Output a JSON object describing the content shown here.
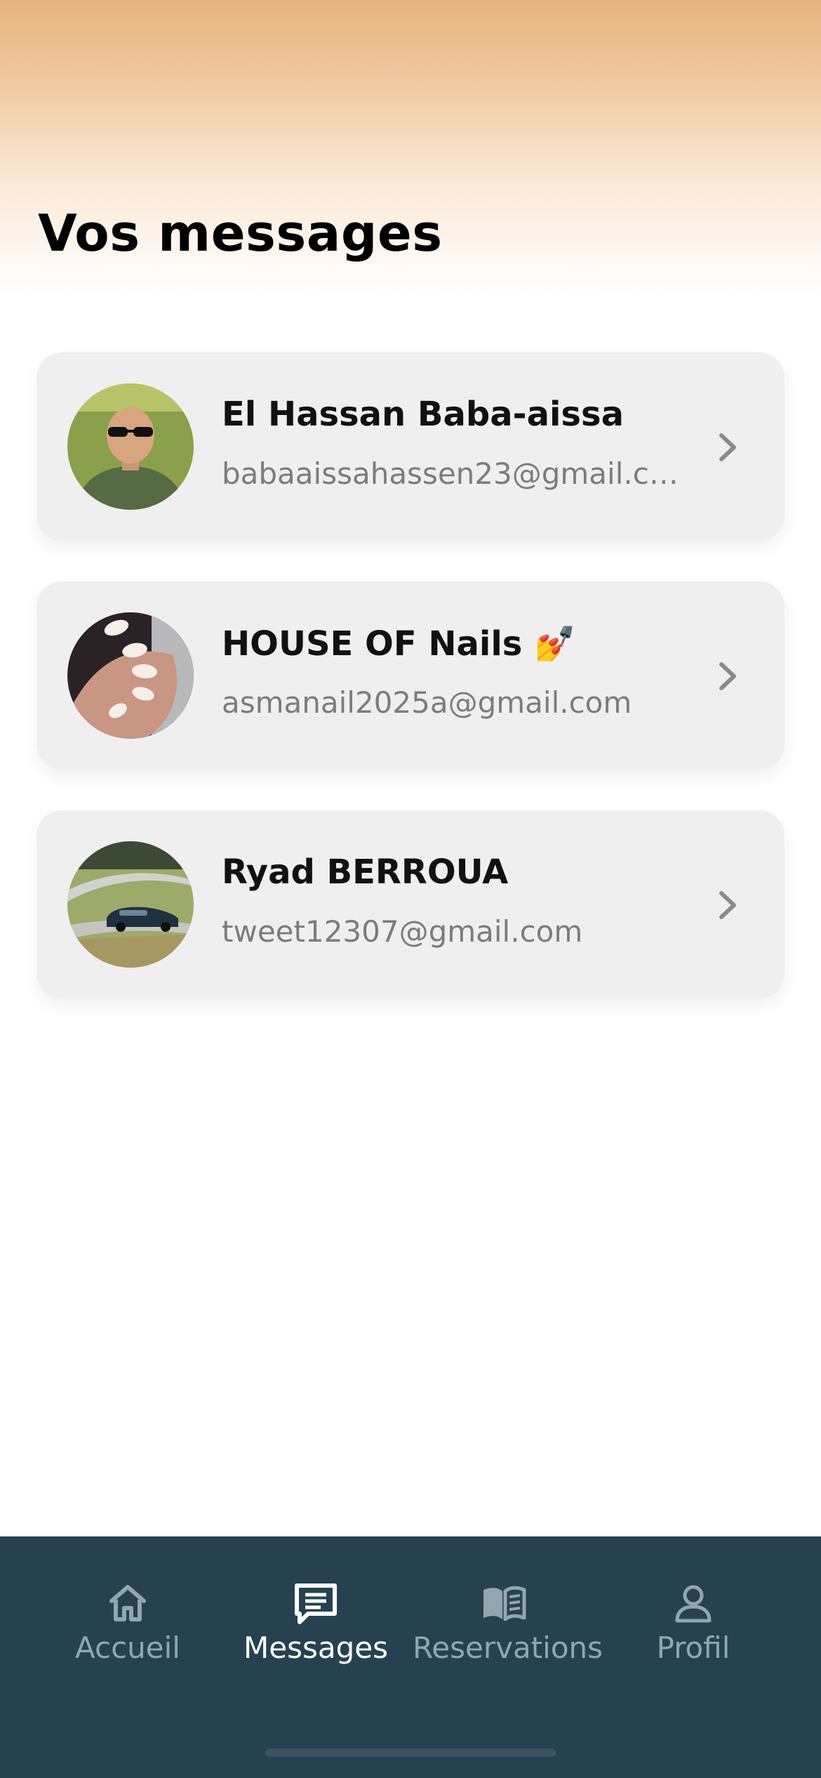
{
  "header": {
    "title": "Vos messages"
  },
  "conversations": [
    {
      "name": "El Hassan Baba-aissa",
      "email": "babaaissahassen23@gmail.c…",
      "avatar_icon": "person-photo"
    },
    {
      "name": "HOUSE OF Nails 💅",
      "email": "asmanail2025a@gmail.com",
      "avatar_icon": "nails-photo"
    },
    {
      "name": "Ryad BERROUA",
      "email": "tweet12307@gmail.com",
      "avatar_icon": "car-photo"
    }
  ],
  "tabbar": {
    "items": [
      {
        "label": "Accueil",
        "icon": "home-icon",
        "active": false
      },
      {
        "label": "Messages",
        "icon": "messages-icon",
        "active": true
      },
      {
        "label": "Reservations",
        "icon": "book-icon",
        "active": false
      },
      {
        "label": "Profil",
        "icon": "profile-icon",
        "active": false
      }
    ]
  },
  "colors": {
    "accent_gradient_top": "#e7b47f",
    "tabbar_background": "#264250",
    "tab_active": "#ffffff",
    "tab_inactive": "#93a6ae",
    "card_background": "#efefef"
  }
}
